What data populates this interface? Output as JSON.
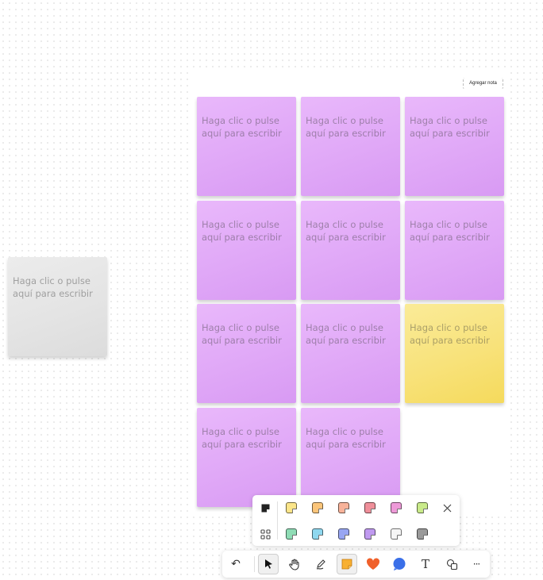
{
  "board": {
    "add_note_label": "Agregar nota"
  },
  "notes": [
    {
      "text": "Haga clic o pulse aquí para escribir",
      "color": "purple"
    },
    {
      "text": "Haga clic o pulse aquí para escribir",
      "color": "purple"
    },
    {
      "text": "Haga clic o pulse aquí para escribir",
      "color": "purple"
    },
    {
      "text": "Haga clic o pulse aquí para escribir",
      "color": "purple"
    },
    {
      "text": "Haga clic o pulse aquí para escribir",
      "color": "purple"
    },
    {
      "text": "Haga clic o pulse aquí para escribir",
      "color": "purple"
    },
    {
      "text": "Haga clic o pulse aquí para escribir",
      "color": "purple"
    },
    {
      "text": "Haga clic o pulse aquí para escribir",
      "color": "purple"
    },
    {
      "text": "Haga clic o pulse aquí para escribir",
      "color": "yellow"
    },
    {
      "text": "Haga clic o pulse aquí para escribir",
      "color": "purple"
    },
    {
      "text": "Haga clic o pulse aquí para escribir",
      "color": "purple"
    }
  ],
  "loose_note": {
    "text": "Haga clic o pulse aquí para escribir",
    "color": "gray"
  },
  "palette": {
    "colors_row1": [
      "#fbe58a",
      "#fbc57a",
      "#f8b39a",
      "#ef8f9a",
      "#ee9ad8",
      "#c9ea8a"
    ],
    "colors_row2": [
      "#8fdcb5",
      "#8fd8ef",
      "#98a6f2",
      "#c09af0",
      "#f6f6f6",
      "#9a9a9a"
    ],
    "close_icon": "close-icon",
    "grid_icon": "grid-icon",
    "color_fill_icon": "note-fill-icon"
  },
  "toolbar": {
    "tools": [
      "undo-icon",
      "select-icon",
      "hand-icon",
      "pen-icon",
      "sticky-note-icon",
      "heart-icon",
      "comment-icon",
      "text-icon",
      "shapes-icon",
      "more-icon"
    ],
    "text_tool_label": "T",
    "more_label": "···",
    "undo_label": "↶",
    "colors": {
      "sticky": "#f8b032",
      "heart": "#f0602a",
      "comment": "#3a6fe8"
    }
  }
}
